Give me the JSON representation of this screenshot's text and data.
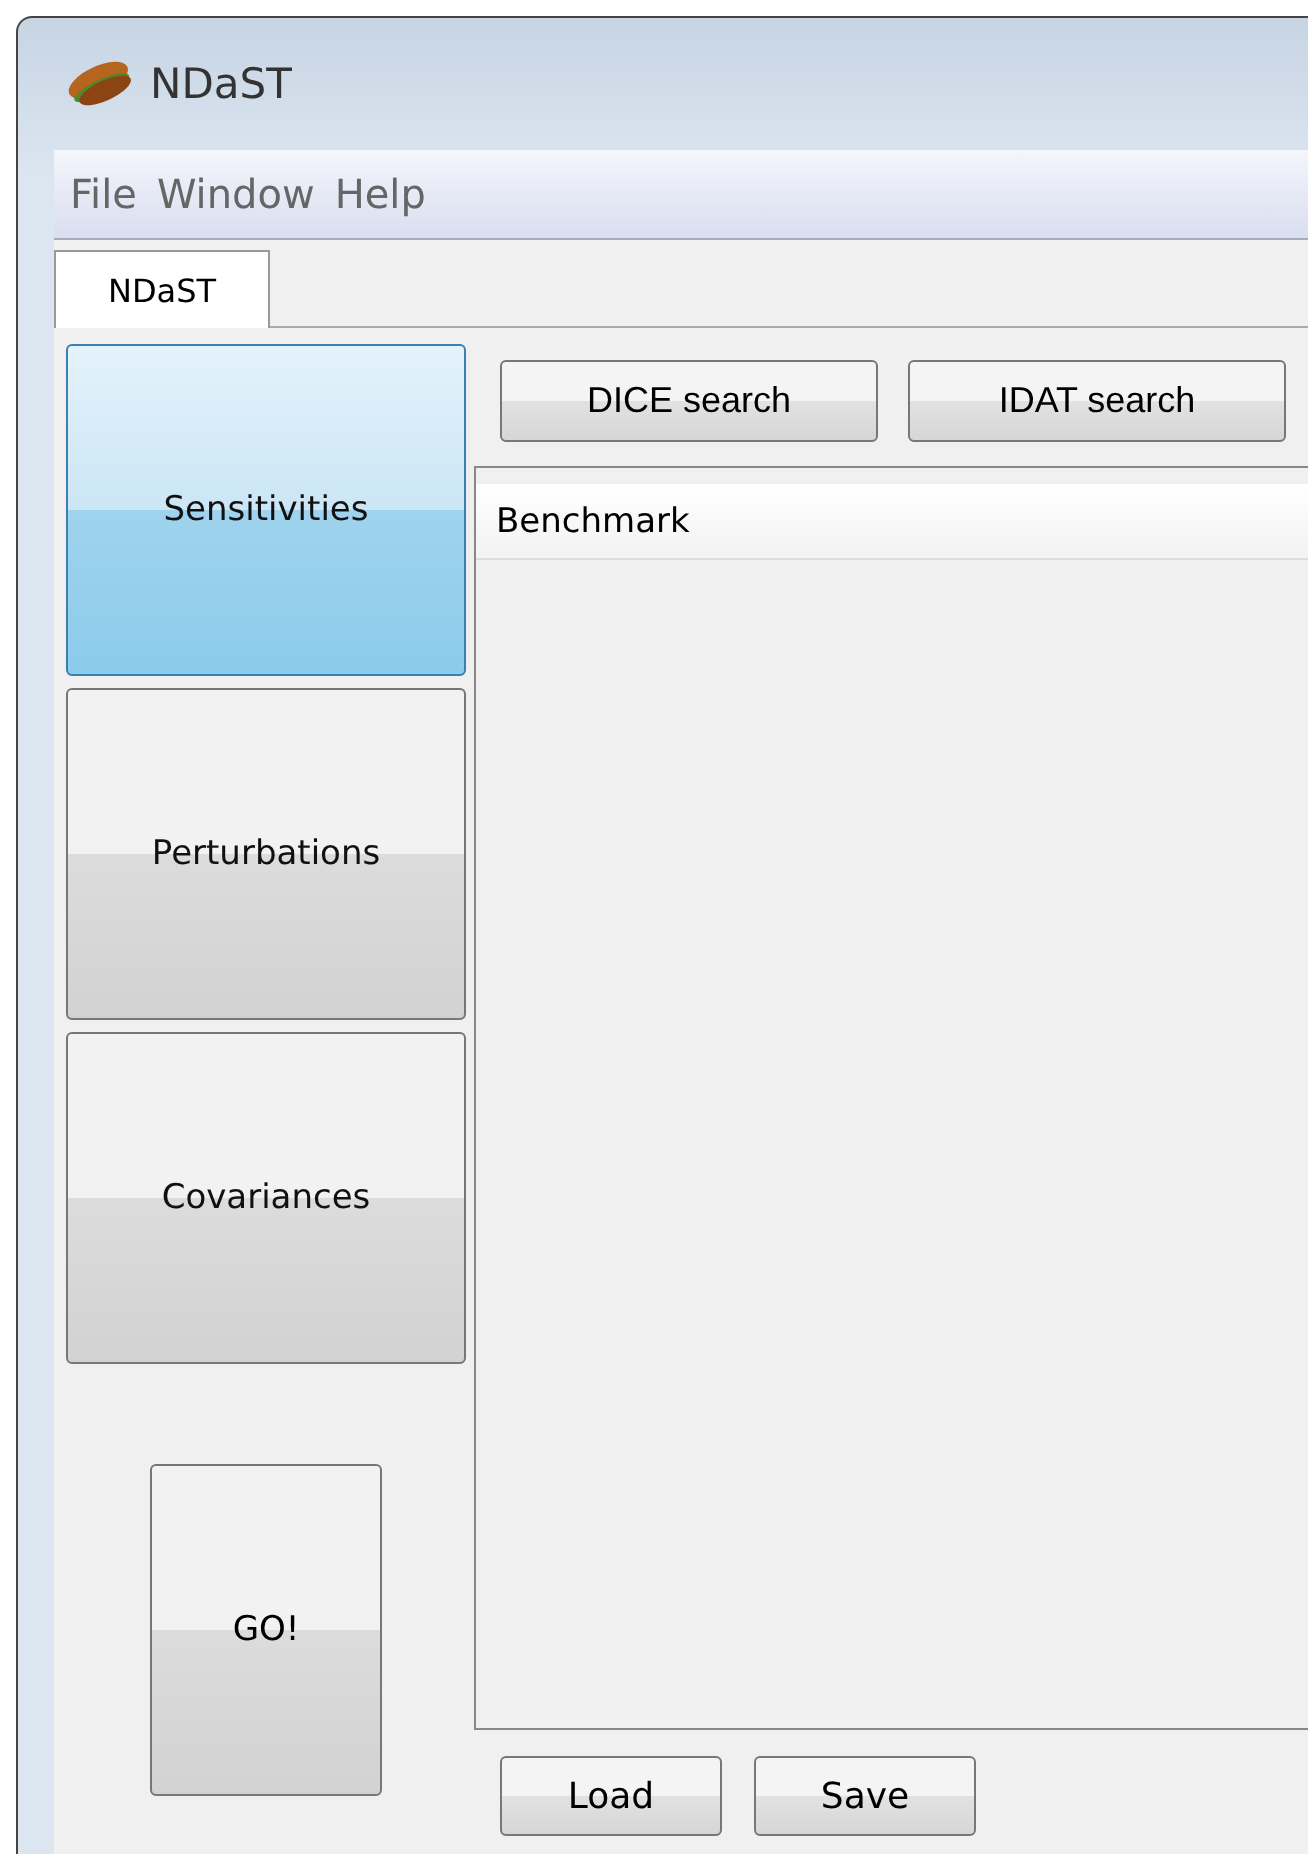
{
  "window": {
    "title": "NDaST"
  },
  "menu": [
    "File",
    "Window",
    "Help"
  ],
  "tabs": [
    {
      "label": "NDaST",
      "selected": true
    }
  ],
  "modes": [
    {
      "label": "Sensitivities",
      "selected": true
    },
    {
      "label": "Perturbations",
      "selected": false
    },
    {
      "label": "Covariances",
      "selected": false
    }
  ],
  "go_button": "GO!",
  "search_buttons": [
    "DICE search",
    "IDAT search"
  ],
  "list": {
    "header": "Benchmark"
  },
  "bottom_buttons": [
    "Load",
    "Save"
  ]
}
